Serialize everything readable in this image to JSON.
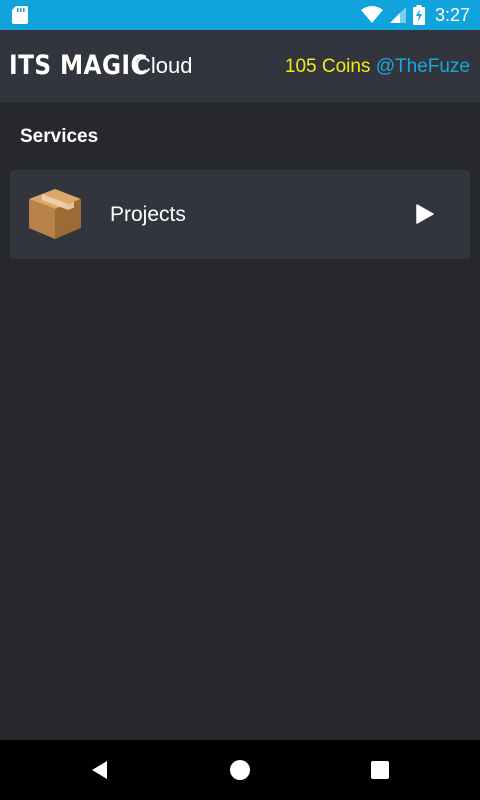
{
  "status_bar": {
    "time": "3:27",
    "bg_color": "#11a4dc"
  },
  "header": {
    "logo_text": "ITS MAGIC",
    "title": "Cloud",
    "coins": "105 Coins",
    "username": "@TheFuze",
    "coins_color": "#f3eb10",
    "username_color": "#1aa7e0"
  },
  "services": {
    "title": "Services",
    "items": [
      {
        "label": "Projects",
        "icon": "box-icon",
        "action_icon": "play-icon"
      }
    ]
  },
  "nav_bar": {
    "buttons": [
      "back-icon",
      "home-icon",
      "recents-icon"
    ]
  }
}
